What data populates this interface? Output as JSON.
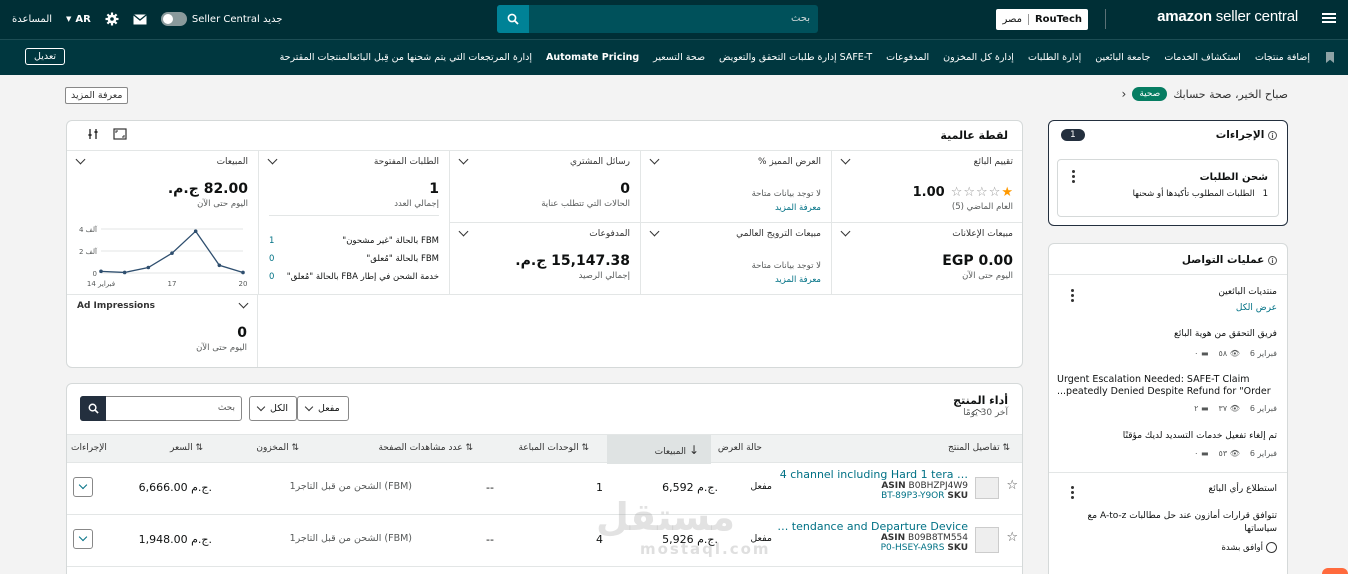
{
  "topbar": {
    "logo_brand": "amazon",
    "logo_product": "seller central",
    "store_name": "RouTech",
    "store_market": "مصر",
    "search_placeholder": "بحث",
    "toggle_label": "Seller Central جديد",
    "language": "AR",
    "help": "المساعدة"
  },
  "nav": {
    "items": [
      "إضافة منتجات",
      "استكشاف الخدمات",
      "جامعة البائعين",
      "إدارة الطلبات",
      "إدارة كل المخزون",
      "المدفوعات",
      "إدارة طلبات التحقق والتعويض SAFE-T",
      "صحة التسعير",
      "Automate Pricing",
      "إدارة المرتجعات التي يتم شحنها من قِبل البائعالمنتجات المقترحة"
    ],
    "edit": "تعديل"
  },
  "greeting": {
    "text": "صباح الخير، صحة حسابك",
    "badge": "صحية",
    "learn_more": "معرفة المزيد"
  },
  "snapshot": {
    "title": "لقطة عالمية",
    "seller_rating": {
      "title": "تقييم البائع",
      "value": "1.00",
      "sub": "العام الماضي (5)",
      "stars_filled": 1,
      "stars_total": 5
    },
    "featured_offer": {
      "title": "العرض المميز %",
      "nodata": "لا توجد بيانات متاحة",
      "link": "معرفة المزيد"
    },
    "buyer_messages": {
      "title": "رسائل المشتري",
      "value": "0",
      "sub": "الحالات التي تتطلب عناية"
    },
    "open_orders": {
      "title": "الطلبات المفتوحة",
      "value": "1",
      "sub": "إجمالي العدد",
      "rows": [
        {
          "label": "FBM بالحالة \"غير مشحون\"",
          "count": "1"
        },
        {
          "label": "FBM بالحالة \"مُعلق\"",
          "count": "0"
        },
        {
          "label": "خدمة الشحن في إطار FBA بالحالة \"مُعلق\"",
          "count": "0"
        }
      ]
    },
    "sales": {
      "title": "المبيعات",
      "value": "82.00 ج.م.",
      "sub": "اليوم حتى الآن",
      "chart": {
        "ylabels": [
          "4 آلف",
          "2 آلف",
          "0"
        ],
        "xlabels": [
          "14 فبراير",
          "17",
          "20"
        ]
      }
    },
    "ad_sales": {
      "title": "مبيعات الإعلانات",
      "value": "EGP 0.00",
      "sub": "اليوم حتى الآن"
    },
    "global_promo": {
      "title": "مبيعات الترويج العالمي",
      "nodata": "لا توجد بيانات متاحة",
      "link": "معرفة المزيد"
    },
    "payments": {
      "title": "المدفوعات",
      "value": "15,147.38 ج.م.",
      "sub": "إجمالي الرصيد"
    },
    "ad_impressions": {
      "title": "Ad Impressions",
      "value": "0",
      "sub": "اليوم حتى الآن"
    }
  },
  "chart_data": {
    "type": "line",
    "x": [
      "14",
      "15",
      "16",
      "17",
      "18",
      "19",
      "20"
    ],
    "values": [
      150,
      50,
      500,
      1800,
      3800,
      700,
      50
    ],
    "ylim": [
      0,
      4000
    ],
    "xlabel": "",
    "ylabel": "",
    "yticks": [
      "0",
      "2 آلف",
      "4 آلف"
    ],
    "xticks": [
      "14 فبراير",
      "17",
      "20"
    ]
  },
  "product": {
    "title": "أداء المنتج",
    "subtitle": "آخر 30 يومًا",
    "search_placeholder": "بحث",
    "filter_all": "الكل",
    "filter_active": "مفعل",
    "columns": [
      "تفاصيل المنتج",
      "حالة العرض",
      "المبيعات",
      "الوحدات المباعة",
      "عدد مشاهدات الصفحة",
      "المخزون",
      "السعر",
      "الإجراءات"
    ],
    "rows": [
      {
        "name": "4 channel including Hard 1 tera …",
        "asin_label": "ASIN",
        "asin": "B0BHZPJ4W9",
        "sku_label": "SKU",
        "sku": "BT-89P3-Y9OR",
        "status": "مفعل",
        "sales": "6,592 ج.م.",
        "units": "1",
        "views": "--",
        "inventory": "1الشحن من قبل التاجر (FBM)",
        "price": "6,666.00 ج.م."
      },
      {
        "name": "… tendance and Departure Device",
        "asin_label": "ASIN",
        "asin": "B09B8TM554",
        "sku_label": "SKU",
        "sku": "P0-HSEY-A9RS",
        "status": "مفعل",
        "sales": "5,926 ج.م.",
        "units": "4",
        "views": "--",
        "inventory": "1الشحن من قبل التاجر (FBM)",
        "price": "1,948.00 ج.م."
      }
    ]
  },
  "actions_panel": {
    "title": "الإجراءات",
    "count": "1",
    "item_title": "شحن الطلبات",
    "item_count": "1",
    "item_text": "الطلبات المطلوب تأكيدها أو شحنها"
  },
  "comms_panel": {
    "title": "عمليات التواصل",
    "forums_title": "منتديات البائعين",
    "view_all": "عرض الكل",
    "posts": [
      {
        "title": "فريق التحقق من هوية البائع",
        "date": "فبراير 6",
        "views": "٥٨",
        "comments": "٠"
      },
      {
        "title": "Urgent Escalation Needed: SAFE-T Claim ...peatedly Denied Despite Refund for \"Order",
        "date": "فبراير 6",
        "views": "٣٧",
        "comments": "٢"
      },
      {
        "title": "تم إلغاء تفعيل خدمات التسديد لديك مؤقتًا",
        "date": "فبراير 6",
        "views": "٥٣",
        "comments": "٠"
      }
    ],
    "survey_title": "استطلاع رأي البائع",
    "survey_question": "تتوافق قرارات أمازون عند حل مطالبات A-to-z مع سياساتها",
    "survey_option": "أوافق بشدة"
  },
  "watermark": {
    "text": "مستقل",
    "sub": "mostaql.com"
  }
}
